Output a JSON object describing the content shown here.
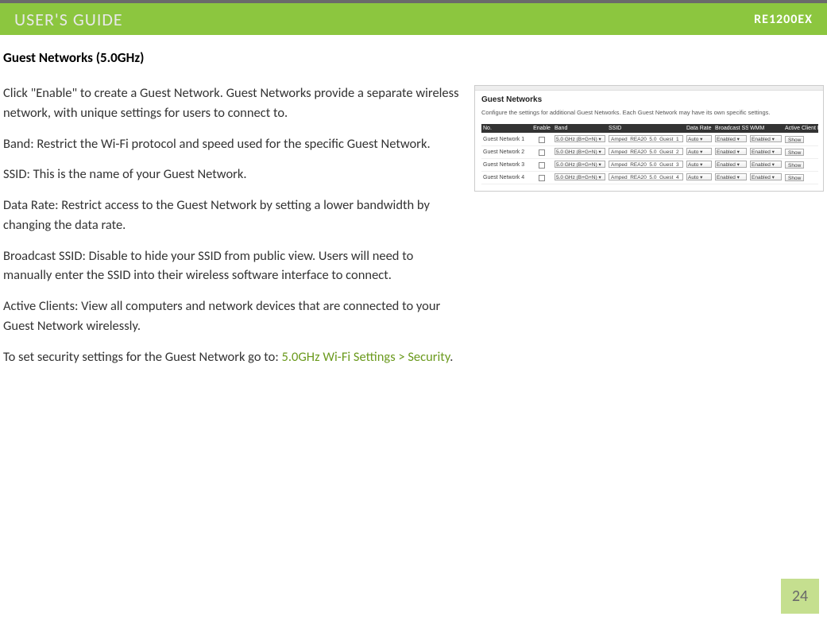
{
  "header": {
    "title": "USER'S GUIDE",
    "model": "RE1200EX"
  },
  "section_title": "Guest Networks (5.0GHz)",
  "paragraphs": {
    "p1": "Click \"Enable\" to create a Guest Network. Guest Networks provide a separate wireless network, with unique settings for users to connect to.",
    "p2": "Band: Restrict the Wi-Fi protocol and speed used for the specific Guest Network.",
    "p3": "SSID: This is the name of your Guest Network.",
    "p4": "Data Rate: Restrict access to the Guest Network by setting a lower bandwidth by changing the data rate.",
    "p5": "Broadcast SSID: Disable to hide your SSID from public view. Users will need to manually enter the SSID into their wireless software interface to connect.",
    "p6": "Active Clients: View all computers and network devices that are connected to your Guest Network wirelessly.",
    "p7_prefix": "To set security settings for the Guest Network go to: ",
    "p7_link": "5.0GHz Wi-Fi Settings > Security",
    "p7_suffix": "."
  },
  "panel": {
    "heading": "Guest Networks",
    "desc": "Configure the settings for additional Guest Networks. Each Guest Network may have its own specific settings.",
    "columns": {
      "no": "No.",
      "enable": "Enable",
      "band": "Band",
      "ssid": "SSID",
      "rate": "Data Rate",
      "bcast": "Broadcast SSID",
      "wmm": "WMM",
      "active": "Active Client List"
    },
    "rows": [
      {
        "no": "Guest Network 1",
        "band": "5.0 GHz (B+G+N) ▾",
        "ssid": "Amped_REA20_5.0_Guest_1",
        "rate": "Auto ▾",
        "bcast": "Enabled ▾",
        "wmm": "Enabled ▾",
        "show": "Show"
      },
      {
        "no": "Guest Network 2",
        "band": "5.0 GHz (B+G+N) ▾",
        "ssid": "Amped_REA20_5.0_Guest_2",
        "rate": "Auto ▾",
        "bcast": "Enabled ▾",
        "wmm": "Enabled ▾",
        "show": "Show"
      },
      {
        "no": "Guest Network 3",
        "band": "5.0 GHz (B+G+N) ▾",
        "ssid": "Amped_REA20_5.0_Guest_3",
        "rate": "Auto ▾",
        "bcast": "Enabled ▾",
        "wmm": "Enabled ▾",
        "show": "Show"
      },
      {
        "no": "Guest Network 4",
        "band": "5.0 GHz (B+G+N) ▾",
        "ssid": "Amped_REA20_5.0_Guest_4",
        "rate": "Auto ▾",
        "bcast": "Enabled ▾",
        "wmm": "Enabled ▾",
        "show": "Show"
      }
    ]
  },
  "page_number": "24"
}
